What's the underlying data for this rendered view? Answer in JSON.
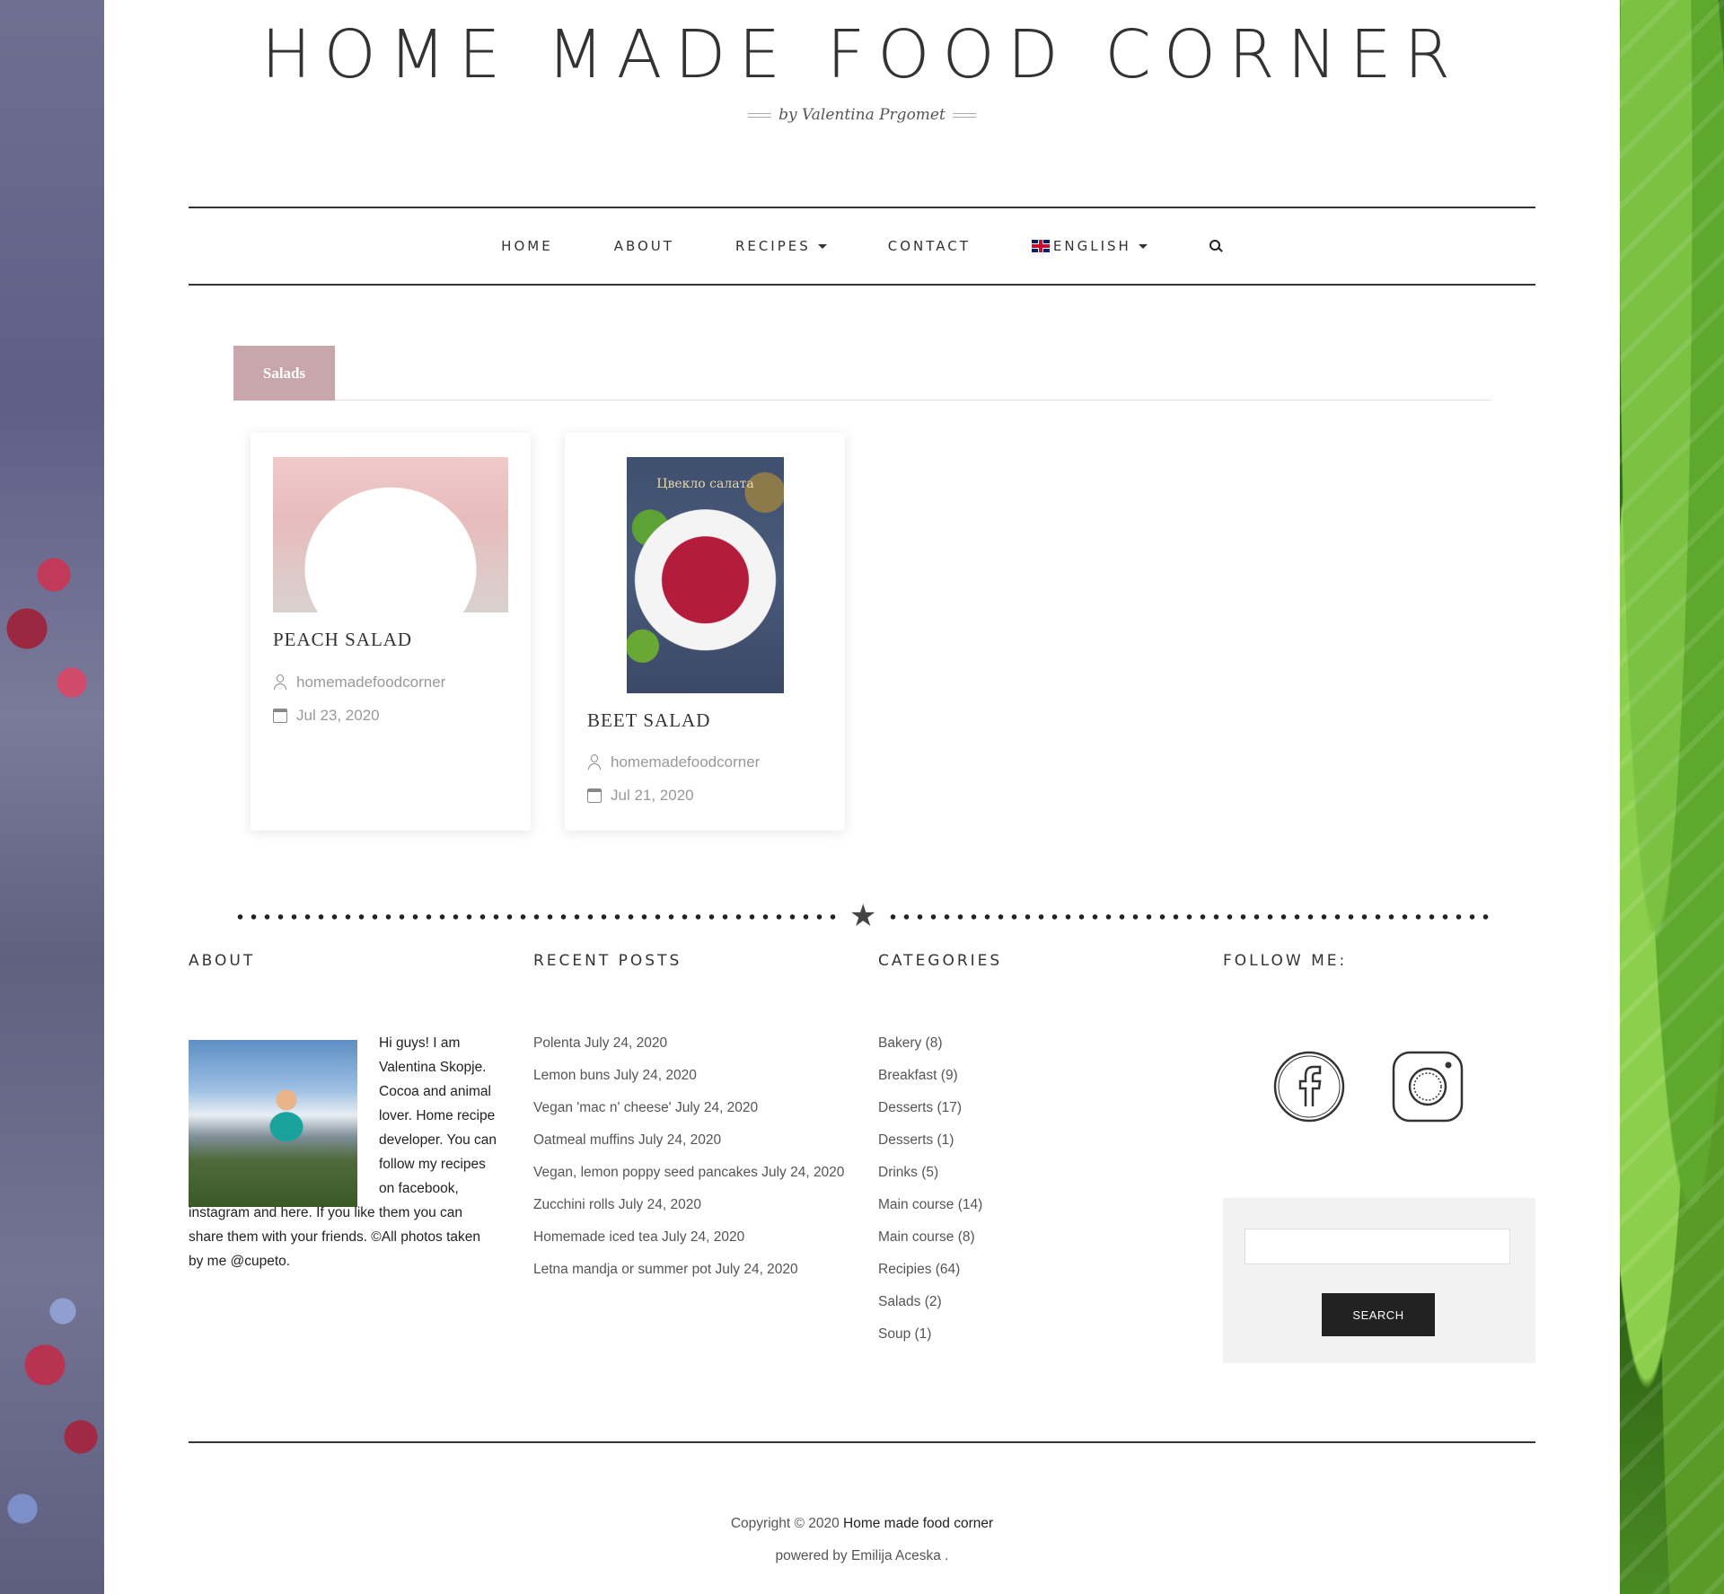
{
  "header": {
    "title": "HOME MADE FOOD CORNER",
    "tagline": "by Valentina Prgomet"
  },
  "nav": {
    "items": [
      {
        "label": "HOME"
      },
      {
        "label": "ABOUT"
      },
      {
        "label": "RECIPES"
      },
      {
        "label": "CONTACT"
      },
      {
        "label": "ENGLISH"
      }
    ],
    "search_icon": "search-icon"
  },
  "category": {
    "active_tab": "Salads"
  },
  "posts": [
    {
      "title": "PEACH SALAD",
      "author": "homemadefoodcorner",
      "date": "Jul 23, 2020"
    },
    {
      "title": "BEET SALAD",
      "author": "homemadefoodcorner",
      "date": "Jul 21, 2020",
      "image_text": "Цвекло салата"
    }
  ],
  "footer": {
    "about": {
      "title": "ABOUT",
      "text": "Hi guys! I am Valentina Skopje. Cocoa and animal lover. Home recipe developer. You can follow my recipes on facebook, instagram and here. If you like them you can share them with your friends. ©All photos taken by me @cupeto."
    },
    "recent_posts": {
      "title": "RECENT POSTS",
      "items": [
        "Polenta July 24, 2020",
        "Lemon buns July 24, 2020",
        "Vegan 'mac n' cheese' July 24, 2020",
        "Oatmeal muffins July 24, 2020",
        "Vegan, lemon poppy seed pancakes July 24, 2020",
        "Zucchini rolls July 24, 2020",
        "Homemade iced tea July 24, 2020",
        "Letna mandja or summer pot July 24, 2020"
      ]
    },
    "categories": {
      "title": "CATEGORIES",
      "items": [
        "Bakery (8)",
        "Breakfast (9)",
        "Desserts (17)",
        "Desserts (1)",
        "Drinks (5)",
        "Main course (14)",
        "Main course (8)",
        "Recipies (64)",
        "Salads (2)",
        "Soup (1)"
      ]
    },
    "follow": {
      "title": "FOLLOW ME:",
      "icons": [
        "facebook-icon",
        "instagram-icon"
      ]
    },
    "search": {
      "value": "",
      "button_label": "SEARCH"
    },
    "copyright_prefix": "Copyright © 2020",
    "copyright_site": "Home made food corner",
    "powered": "powered by Emilija Aceska ."
  },
  "colors": {
    "accent_tab": "#c9a5ac",
    "text": "#333333",
    "button": "#222222"
  }
}
